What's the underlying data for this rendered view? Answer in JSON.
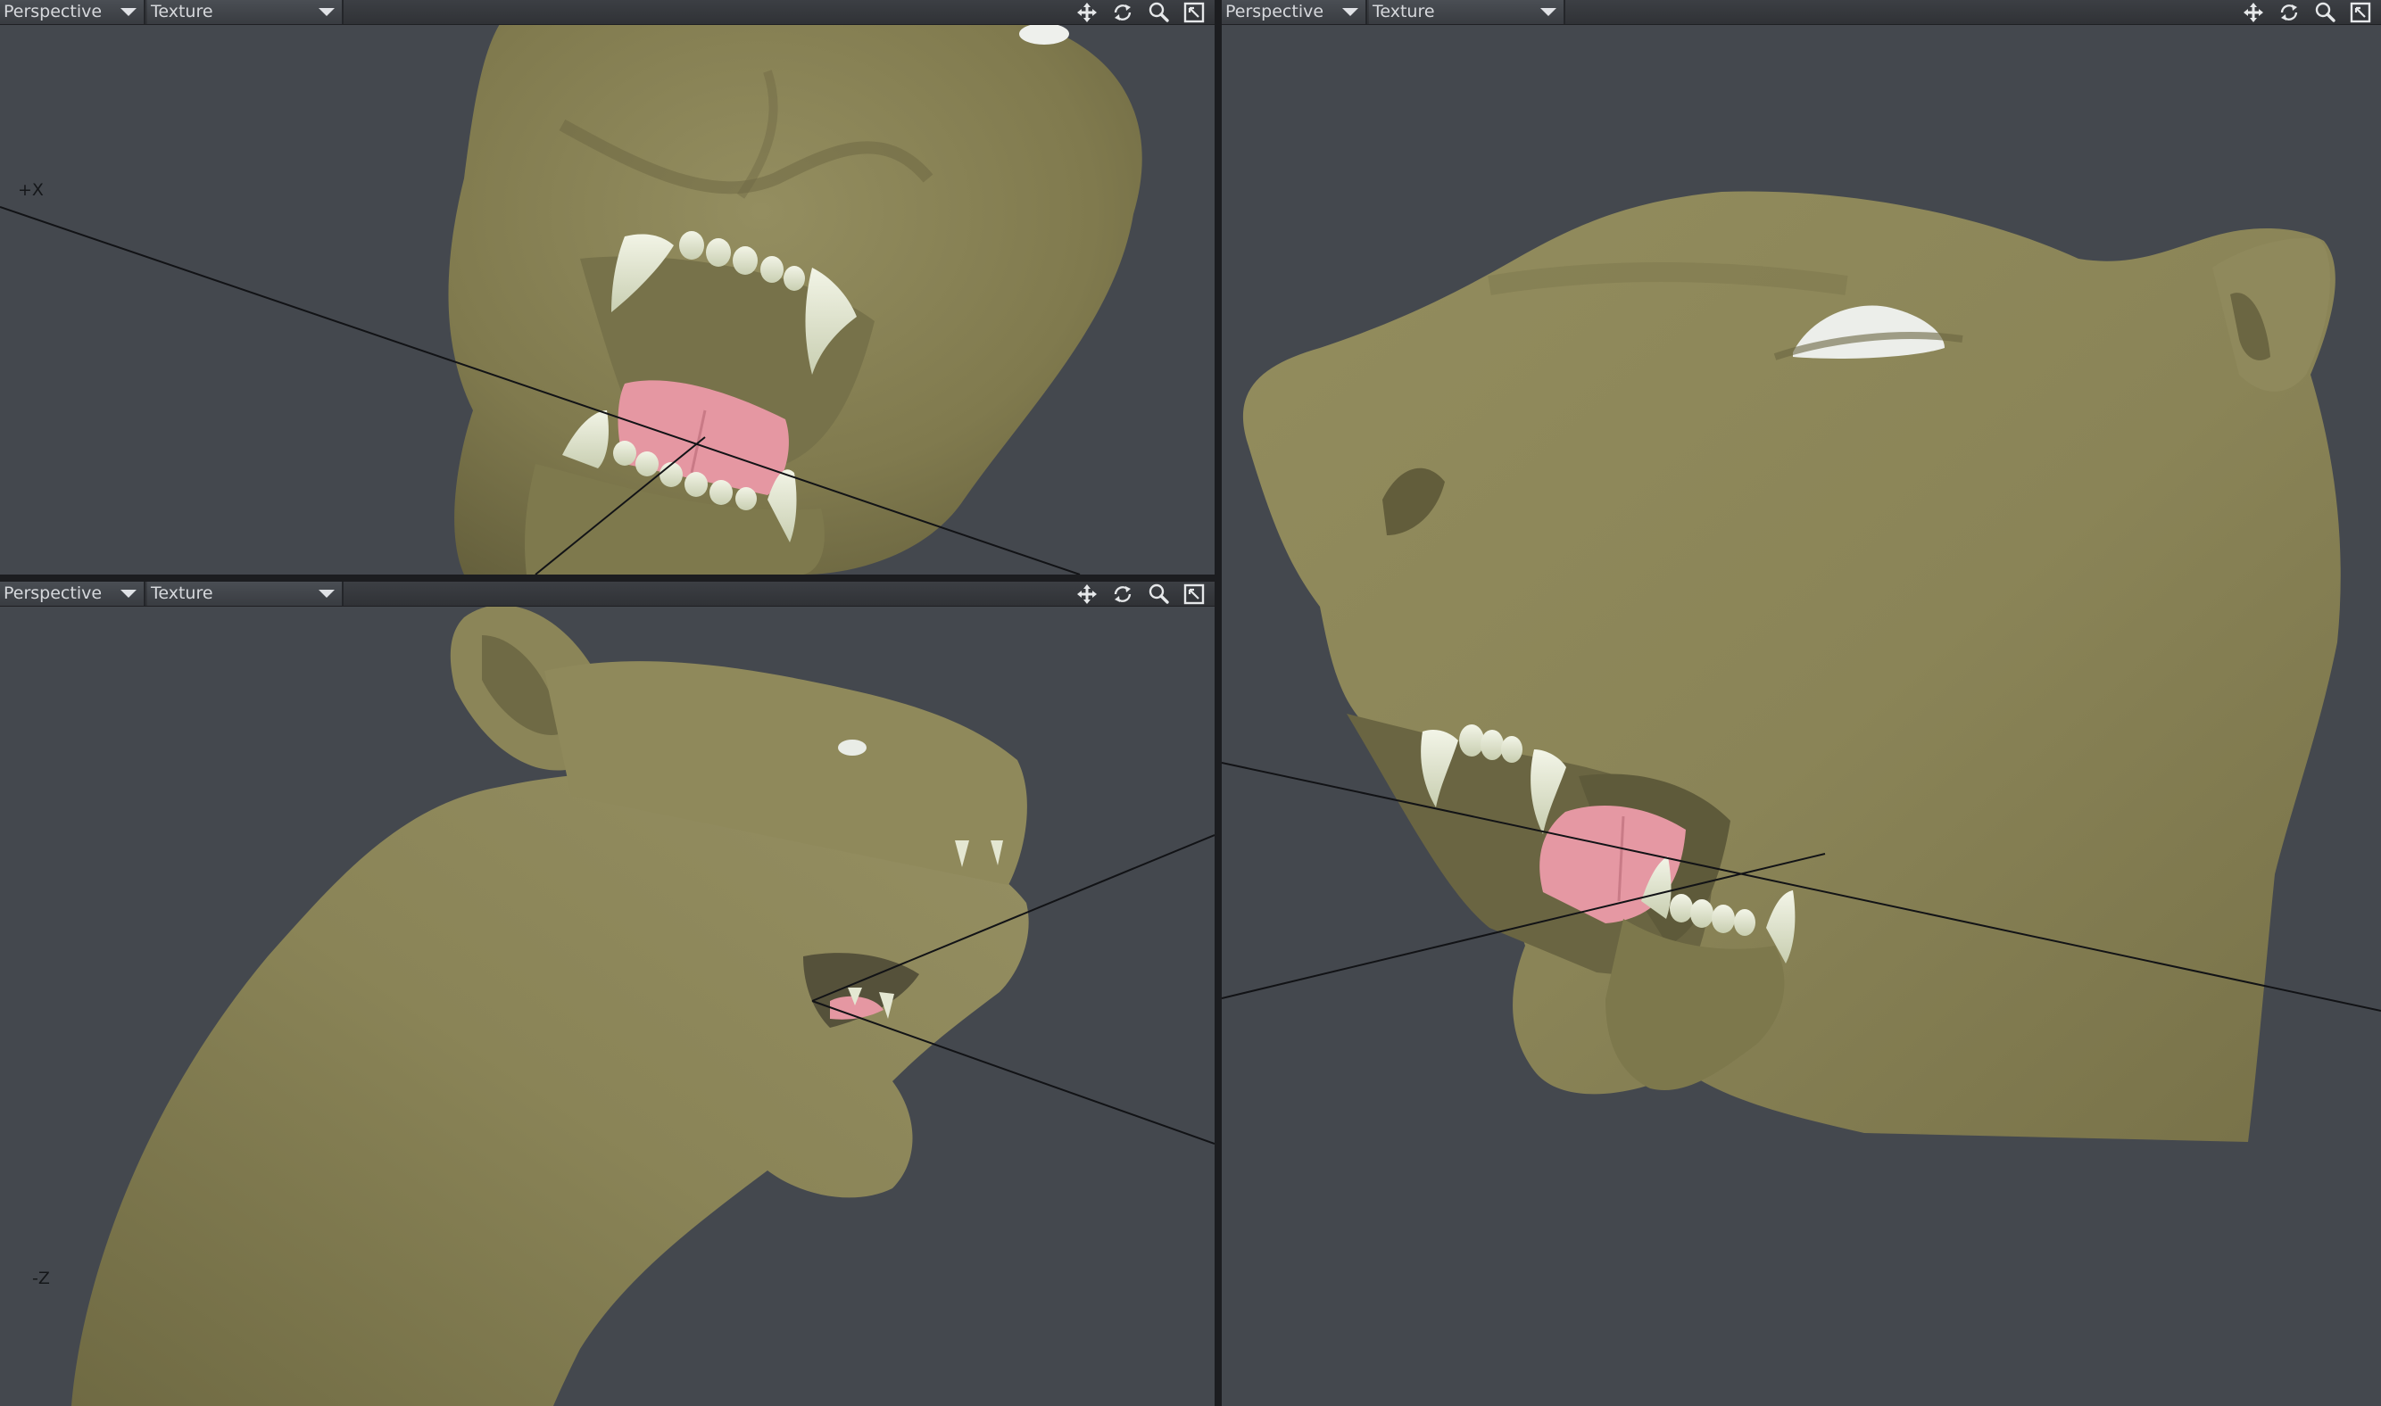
{
  "viewports": {
    "top_left": {
      "view_mode": "Perspective",
      "shading_mode": "Texture",
      "axis_label": "+X"
    },
    "bottom_left": {
      "view_mode": "Perspective",
      "shading_mode": "Texture",
      "axis_label": "-Z"
    },
    "right": {
      "view_mode": "Perspective",
      "shading_mode": "Texture"
    }
  },
  "tool_icons": [
    "move-view-icon",
    "rotate-view-icon",
    "zoom-view-icon",
    "maximize-viewport-icon"
  ],
  "colors": {
    "viewport_bg": "#44484e",
    "model_skin": "#8a8457",
    "teeth": "#dfe3cc",
    "tongue": "#e59aa3"
  }
}
